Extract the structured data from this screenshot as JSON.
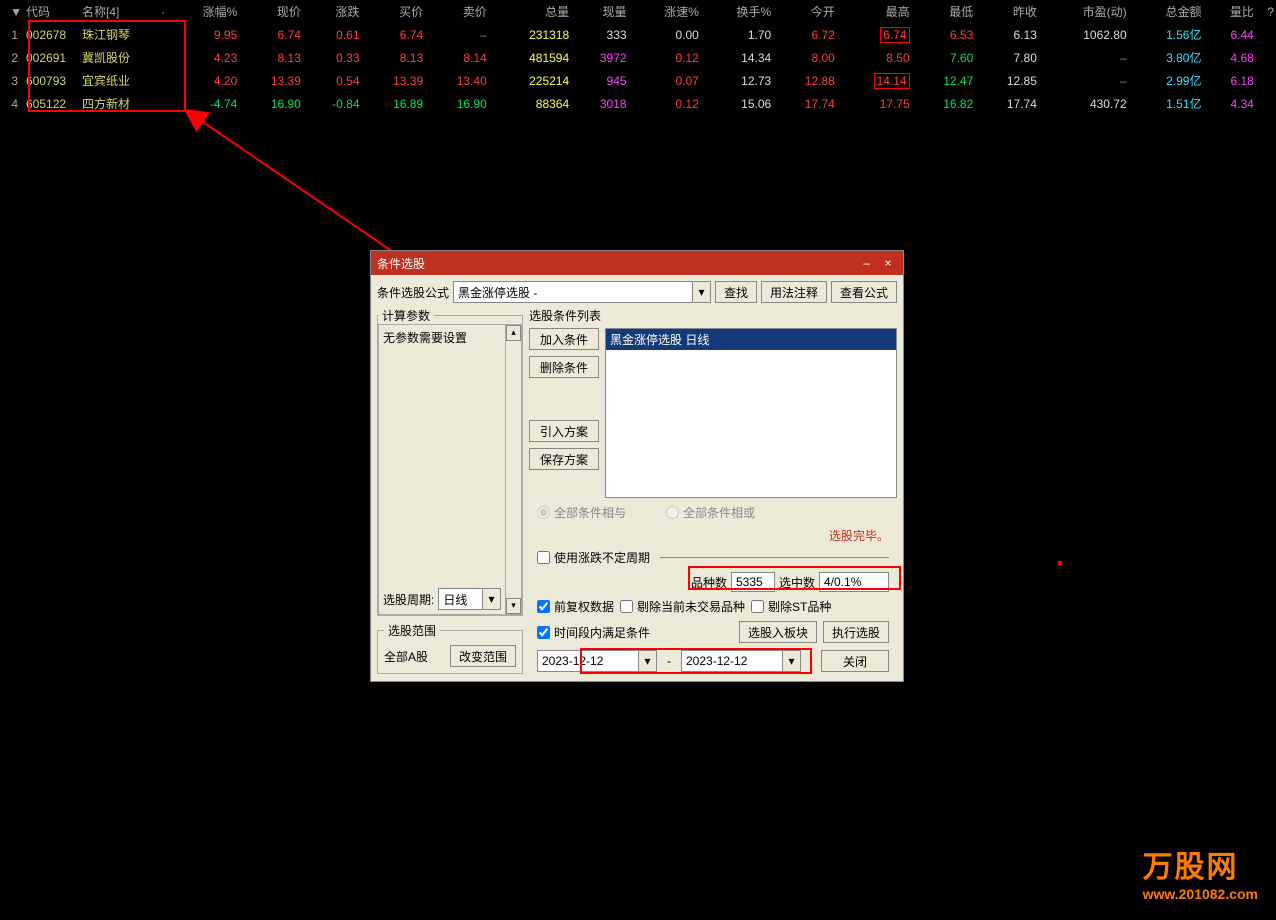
{
  "table": {
    "headers": [
      "",
      "代码",
      "名称[4]",
      "·",
      "涨幅%",
      "现价",
      "涨跌",
      "买价",
      "卖价",
      "总量",
      "现量",
      "涨速%",
      "换手%",
      "今开",
      "最高",
      "最低",
      "昨收",
      "市盈(动)",
      "总金额",
      "量比",
      "?"
    ],
    "rows": [
      {
        "idx": "1",
        "code": "002678",
        "name": "珠江钢琴",
        "pct": "9.95",
        "price": "6.74",
        "chg": "0.61",
        "bid": "6.74",
        "ask": "–",
        "vol": "231318",
        "now": "333",
        "speed": "0.00",
        "turn": "1.70",
        "open": "6.72",
        "high": "6.74",
        "low": "6.53",
        "prev": "6.13",
        "pe": "1062.80",
        "amt": "1.56亿",
        "lb": "6.44",
        "dir": "up"
      },
      {
        "idx": "2",
        "code": "002691",
        "name": "冀凯股份",
        "pct": "4.23",
        "price": "8.13",
        "chg": "0.33",
        "bid": "8.13",
        "ask": "8.14",
        "vol": "481594",
        "now": "3972",
        "speed": "0.12",
        "turn": "14.34",
        "open": "8.00",
        "high": "8.50",
        "low": "7.60",
        "prev": "7.80",
        "pe": "–",
        "amt": "3.80亿",
        "lb": "4.68",
        "dir": "up"
      },
      {
        "idx": "3",
        "code": "600793",
        "name": "宜宾纸业",
        "pct": "4.20",
        "price": "13.39",
        "chg": "0.54",
        "bid": "13.39",
        "ask": "13.40",
        "vol": "225214",
        "now": "945",
        "speed": "0.07",
        "turn": "12.73",
        "open": "12.88",
        "high": "14.14",
        "low": "12.47",
        "prev": "12.85",
        "pe": "–",
        "amt": "2.99亿",
        "lb": "6.18",
        "dir": "up"
      },
      {
        "idx": "4",
        "code": "605122",
        "name": "四方新材",
        "pct": "-4.74",
        "price": "16.90",
        "chg": "-0.84",
        "bid": "16.89",
        "ask": "16.90",
        "vol": "88364",
        "now": "3018",
        "speed": "0.12",
        "turn": "15.06",
        "open": "17.74",
        "high": "17.75",
        "low": "16.82",
        "prev": "17.74",
        "pe": "430.72",
        "amt": "1.51亿",
        "lb": "4.34",
        "dir": "down"
      }
    ]
  },
  "dialog": {
    "title": "条件选股",
    "formula_label": "条件选股公式",
    "formula_value": "黑金涨停选股  -",
    "btn_find": "查找",
    "btn_usage": "用法注释",
    "btn_view": "查看公式",
    "params_legend": "计算参数",
    "params_empty": "无参数需要设置",
    "period_label": "选股周期:",
    "period_value": "日线",
    "cond_title": "选股条件列表",
    "btn_add": "加入条件",
    "btn_del": "删除条件",
    "btn_import": "引入方案",
    "btn_save": "保存方案",
    "cond_item": "黑金涨停选股  日线",
    "radio_and": "全部条件相与",
    "radio_or": "全部条件相或",
    "done_text": "选股完毕。",
    "scope_legend": "选股范围",
    "scope_value": "全部A股",
    "btn_scope": "改变范围",
    "chk_period": "使用涨跌不定周期",
    "lbl_count": "品种数",
    "val_count": "5335",
    "lbl_hit": "选中数",
    "val_hit": "4/0.1%",
    "chk_fq": "前复权数据",
    "chk_rmna": "剔除当前未交易品种",
    "chk_rmst": "剔除ST品种",
    "chk_time": "时间段内满足条件",
    "btn_toblock": "选股入板块",
    "btn_run": "执行选股",
    "date_from": "2023-12-12",
    "date_sep": "-",
    "date_to": "2023-12-12",
    "btn_close": "关闭"
  },
  "brand": {
    "name": "万股网",
    "url": "www.201082.com"
  }
}
